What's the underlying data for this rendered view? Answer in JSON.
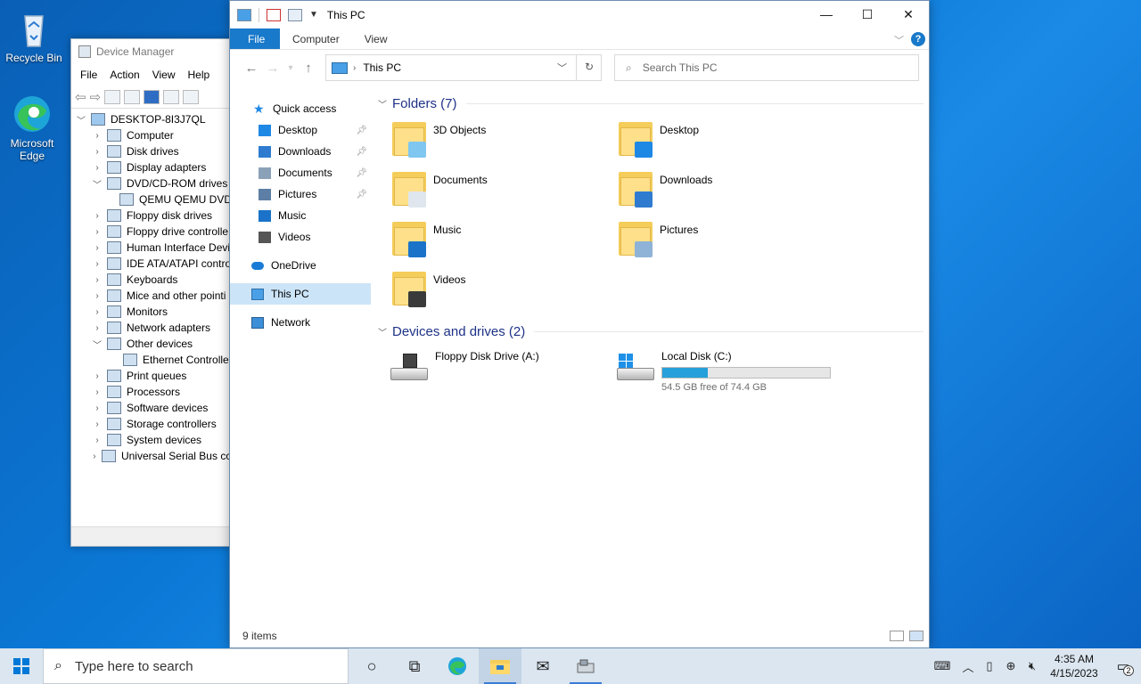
{
  "desktop": {
    "icons": [
      {
        "label": "Recycle Bin",
        "icon": "recycle-bin-icon"
      },
      {
        "label": "Microsoft Edge",
        "icon": "edge-icon"
      }
    ]
  },
  "device_manager": {
    "title": "Device Manager",
    "menu": [
      "File",
      "Action",
      "View",
      "Help"
    ],
    "root": "DESKTOP-8I3J7QL",
    "items": [
      {
        "label": "Computer",
        "state": "collapsed",
        "level": 1
      },
      {
        "label": "Disk drives",
        "state": "collapsed",
        "level": 1
      },
      {
        "label": "Display adapters",
        "state": "collapsed",
        "level": 1
      },
      {
        "label": "DVD/CD-ROM drives",
        "state": "expanded",
        "level": 1
      },
      {
        "label": "QEMU QEMU DVD",
        "state": "leaf",
        "level": 2
      },
      {
        "label": "Floppy disk drives",
        "state": "collapsed",
        "level": 1
      },
      {
        "label": "Floppy drive controlle",
        "state": "collapsed",
        "level": 1
      },
      {
        "label": "Human Interface Devi",
        "state": "collapsed",
        "level": 1
      },
      {
        "label": "IDE ATA/ATAPI contro",
        "state": "collapsed",
        "level": 1
      },
      {
        "label": "Keyboards",
        "state": "collapsed",
        "level": 1
      },
      {
        "label": "Mice and other pointi",
        "state": "collapsed",
        "level": 1
      },
      {
        "label": "Monitors",
        "state": "collapsed",
        "level": 1
      },
      {
        "label": "Network adapters",
        "state": "collapsed",
        "level": 1
      },
      {
        "label": "Other devices",
        "state": "expanded",
        "level": 1
      },
      {
        "label": "Ethernet Controlle",
        "state": "leaf",
        "level": 2
      },
      {
        "label": "Print queues",
        "state": "collapsed",
        "level": 1
      },
      {
        "label": "Processors",
        "state": "collapsed",
        "level": 1
      },
      {
        "label": "Software devices",
        "state": "collapsed",
        "level": 1
      },
      {
        "label": "Storage controllers",
        "state": "collapsed",
        "level": 1
      },
      {
        "label": "System devices",
        "state": "collapsed",
        "level": 1
      },
      {
        "label": "Universal Serial Bus co",
        "state": "collapsed",
        "level": 1
      }
    ]
  },
  "explorer": {
    "title": "This PC",
    "ribbon_tabs": [
      "File",
      "Computer",
      "View"
    ],
    "address": "This PC",
    "search_placeholder": "Search This PC",
    "nav": {
      "quick_access": "Quick access",
      "pinned": [
        {
          "label": "Desktop",
          "color": "#1e88e5"
        },
        {
          "label": "Downloads",
          "color": "#2f7bd0"
        },
        {
          "label": "Documents",
          "color": "#8aa1b8"
        },
        {
          "label": "Pictures",
          "color": "#5d7fa5"
        },
        {
          "label": "Music",
          "color": "#1a73c9"
        },
        {
          "label": "Videos",
          "color": "#555555"
        }
      ],
      "onedrive": "OneDrive",
      "this_pc": "This PC",
      "network": "Network"
    },
    "folders_header": "Folders (7)",
    "folders": [
      {
        "name": "3D Objects",
        "badge_color": "#7fc7f0"
      },
      {
        "name": "Desktop",
        "badge_color": "#1e88e5"
      },
      {
        "name": "Documents",
        "badge_color": "#dfe6ee"
      },
      {
        "name": "Downloads",
        "badge_color": "#2f7bd0"
      },
      {
        "name": "Music",
        "badge_color": "#1a73c9"
      },
      {
        "name": "Pictures",
        "badge_color": "#8fb3d6"
      },
      {
        "name": "Videos",
        "badge_color": "#3a3a3a"
      }
    ],
    "drives_header": "Devices and drives (2)",
    "drives": [
      {
        "name": "Floppy Disk Drive (A:)",
        "has_bar": false,
        "free_text": ""
      },
      {
        "name": "Local Disk (C:)",
        "has_bar": true,
        "used_fraction": 0.27,
        "free_text": "54.5 GB free of 74.4 GB"
      }
    ],
    "status": "9 items"
  },
  "taskbar": {
    "search_placeholder": "Type here to search",
    "clock_time": "4:35 AM",
    "clock_date": "4/15/2023",
    "notification_count": "2"
  }
}
